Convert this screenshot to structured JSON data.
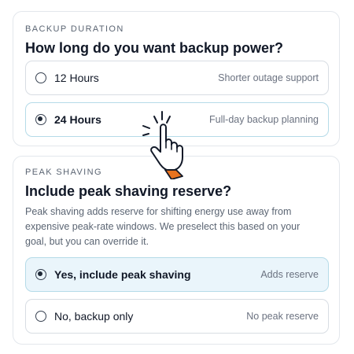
{
  "duration": {
    "eyebrow": "BACKUP DURATION",
    "question": "How long do you want backup power?",
    "options": [
      {
        "label": "12 Hours",
        "note": "Shorter outage support",
        "selected": false
      },
      {
        "label": "24 Hours",
        "note": "Full-day backup planning",
        "selected": true
      }
    ]
  },
  "peak": {
    "eyebrow": "PEAK SHAVING",
    "question": "Include peak shaving reserve?",
    "description": "Peak shaving adds reserve for shifting energy use away from expensive peak-rate windows. We preselect this based on your goal, but you can override it.",
    "options": [
      {
        "label": "Yes, include peak shaving",
        "note": "Adds reserve",
        "selected": true
      },
      {
        "label": "No, backup only",
        "note": "No peak reserve",
        "selected": false
      }
    ]
  },
  "colors": {
    "selected_bg": "#eaf5fb",
    "selected_border": "#b5dbe8",
    "cursor_cuff": "#e8731f"
  },
  "icons": {
    "cursor": "pointing-hand-icon"
  }
}
